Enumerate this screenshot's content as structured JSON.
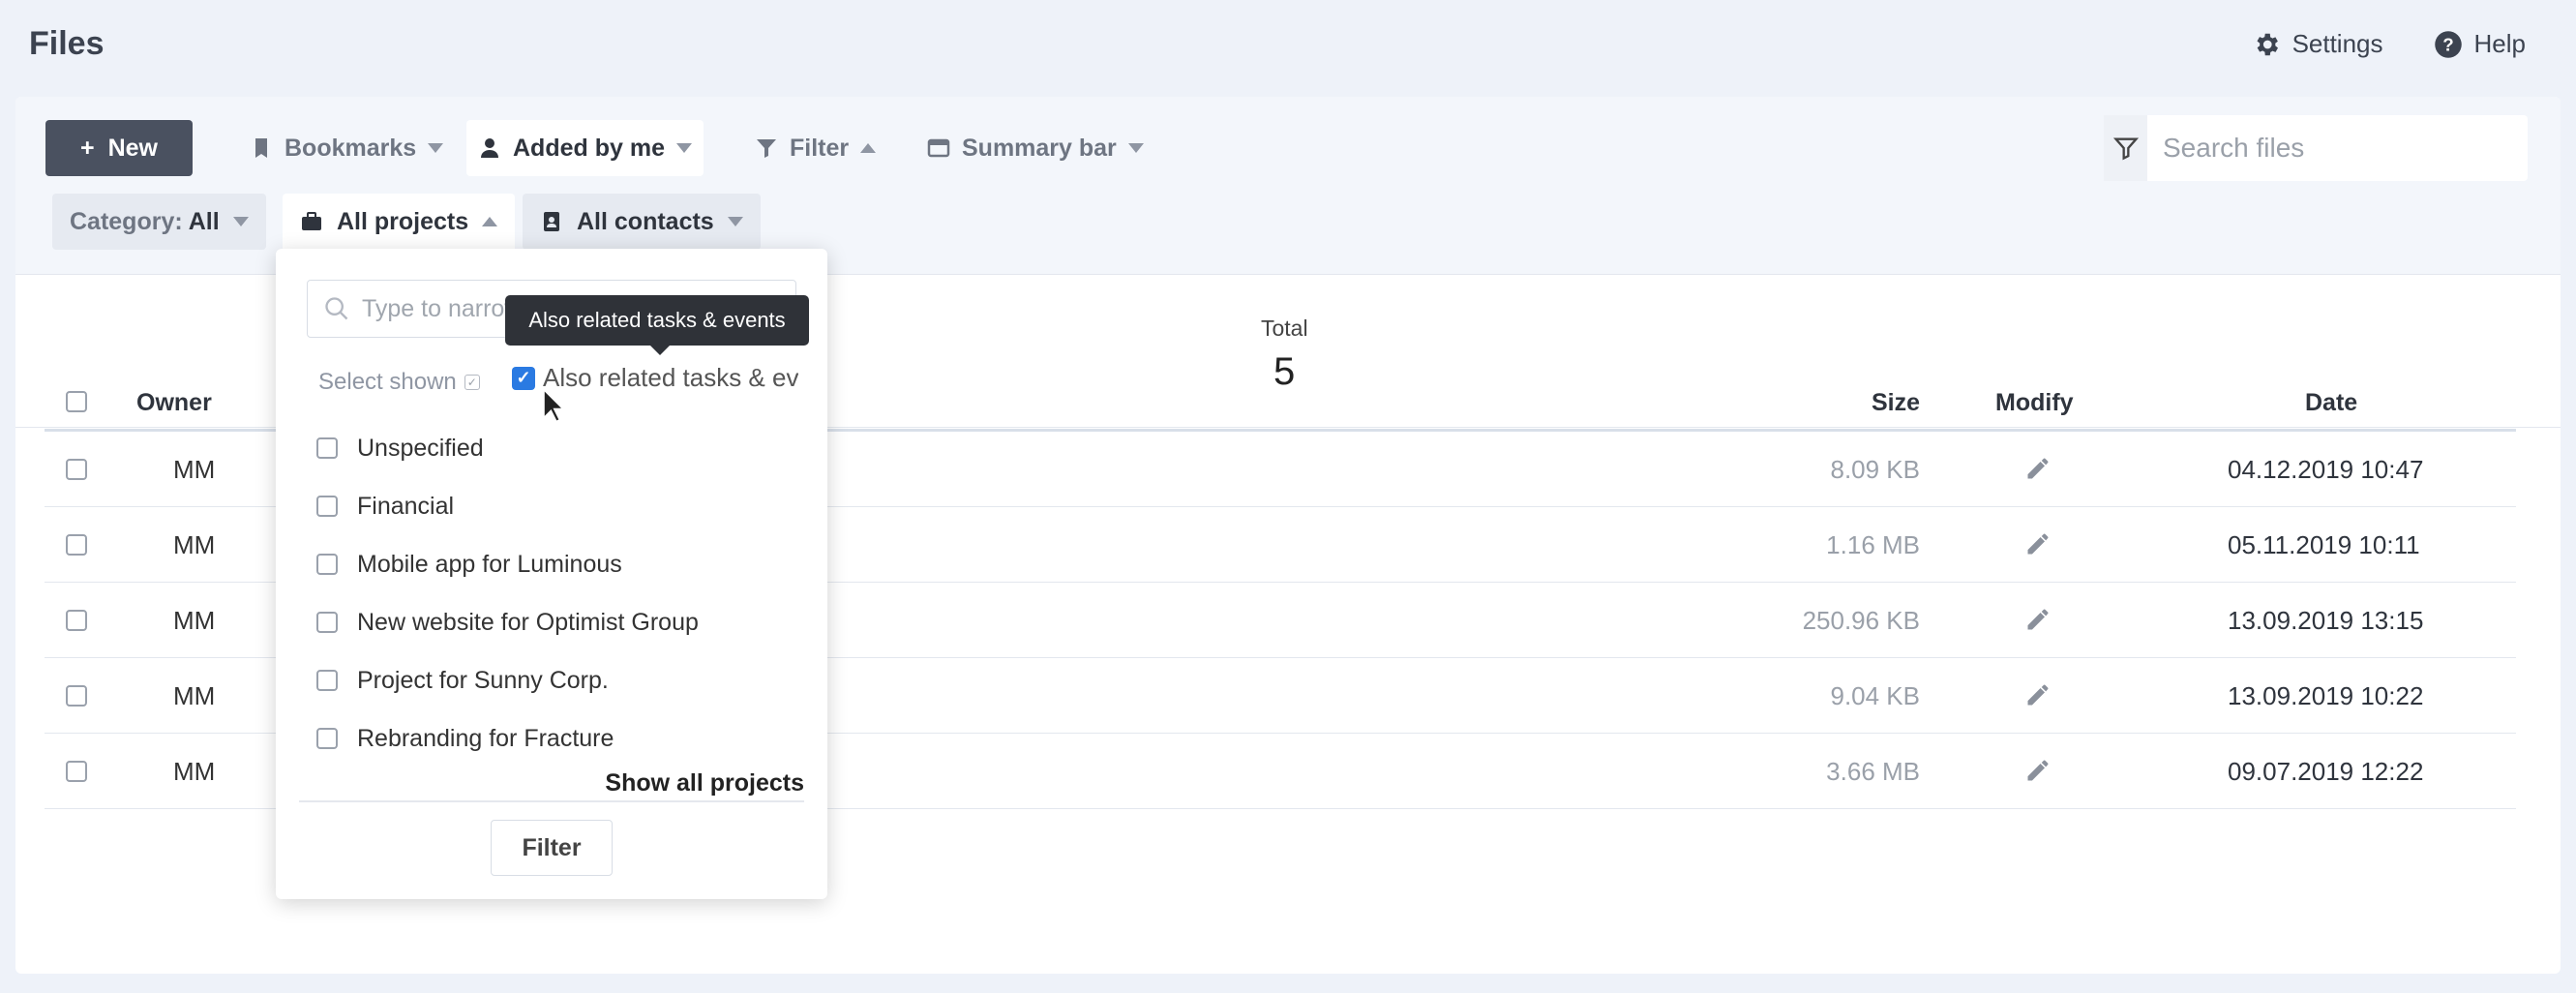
{
  "app": {
    "title": "Files"
  },
  "header": {
    "settings_label": "Settings",
    "help_label": "Help"
  },
  "toolbar": {
    "new_label": "New",
    "bookmarks_label": "Bookmarks",
    "added_by_me_label": "Added by me",
    "filter_label": "Filter",
    "summary_bar_label": "Summary bar",
    "search_placeholder": "Search files"
  },
  "chips": {
    "category_label": "Category:",
    "category_value": "All",
    "projects_label": "All projects",
    "contacts_label": "All contacts"
  },
  "summary": {
    "total_label": "Total",
    "total_value": "5"
  },
  "table": {
    "headers": {
      "owner": "Owner",
      "size": "Size",
      "modify": "Modify",
      "date": "Date"
    },
    "rows": [
      {
        "owner": "MM",
        "size": "8.09 KB",
        "date": "04.12.2019 10:47"
      },
      {
        "owner": "MM",
        "size": "1.16 MB",
        "date": "05.11.2019 10:11"
      },
      {
        "owner": "MM",
        "size": "250.96 KB",
        "date": "13.09.2019 13:15"
      },
      {
        "owner": "MM",
        "size": "9.04 KB",
        "date": "13.09.2019 10:22"
      },
      {
        "owner": "MM",
        "size": "3.66 MB",
        "date": "09.07.2019 12:22"
      }
    ]
  },
  "dropdown": {
    "search_placeholder": "Type to narrow",
    "select_shown_label": "Select shown",
    "also_related_label": "Also related tasks & events",
    "items": [
      "Unspecified",
      "Financial",
      "Mobile app for Luminous",
      "New website for Optimist Group",
      "Project for Sunny Corp.",
      "Rebranding for Fracture"
    ],
    "show_all_label": "Show all projects",
    "filter_button_label": "Filter"
  },
  "tooltip": {
    "text": "Also related tasks & events"
  },
  "colors": {
    "primary_button": "#4a5160",
    "checkbox_checked": "#2a7ae2",
    "background": "#eef2f9"
  }
}
